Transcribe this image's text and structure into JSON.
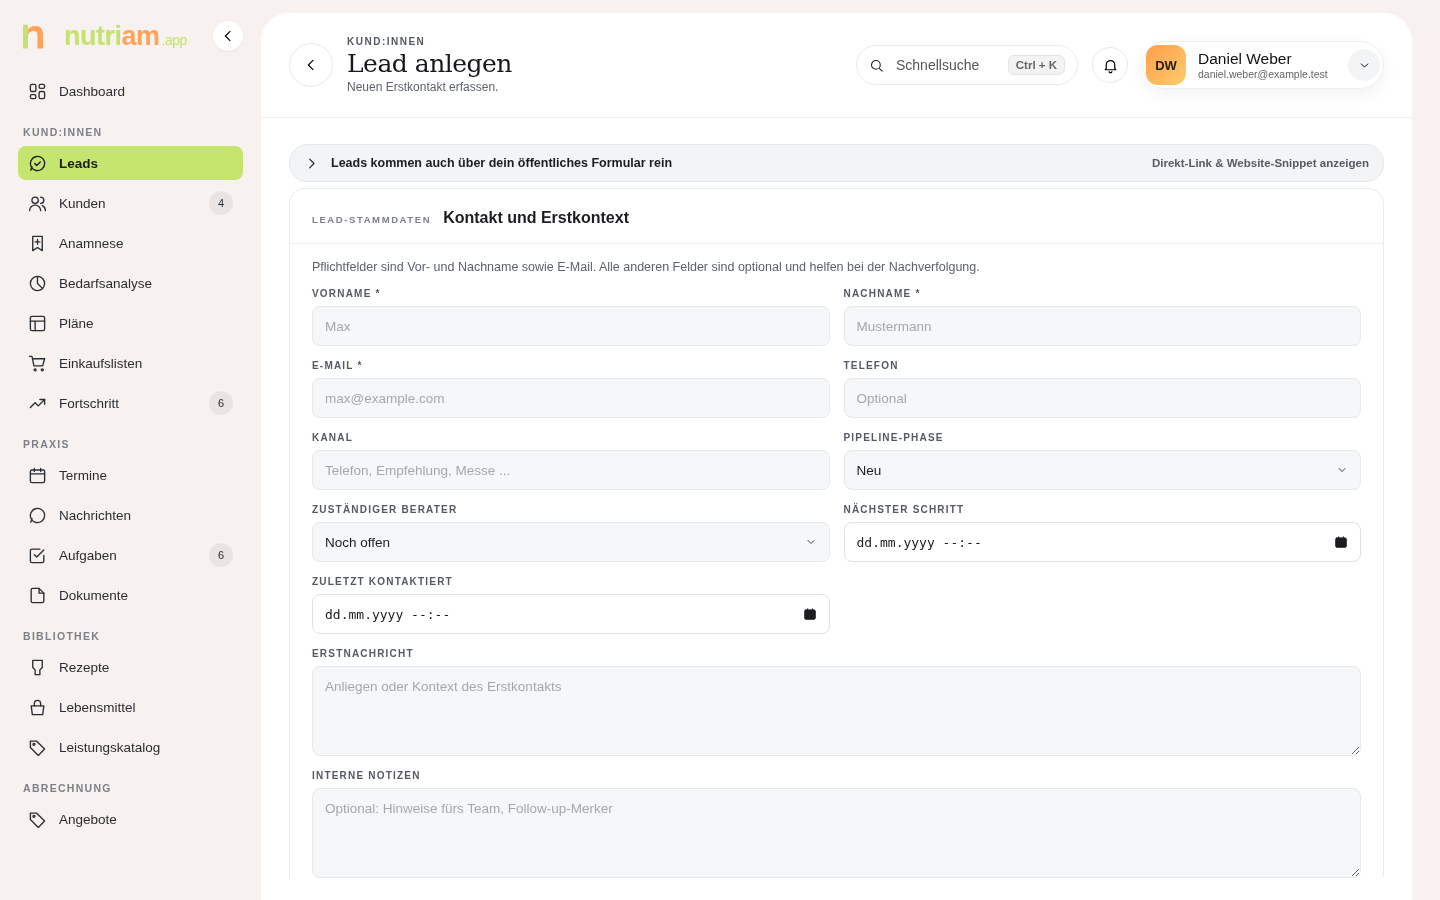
{
  "logo": {
    "text_1": "nutri",
    "text_2": "am",
    "suffix": ".app"
  },
  "sidebar": {
    "sections": [
      {
        "items": [
          {
            "label": "Dashboard",
            "selected": false
          }
        ]
      },
      {
        "heading": "KUND:INNEN",
        "items": [
          {
            "label": "Leads",
            "selected": true
          },
          {
            "label": "Kunden",
            "badge": "4",
            "selected": false
          },
          {
            "label": "Anamnese",
            "selected": false
          },
          {
            "label": "Bedarfsanalyse",
            "selected": false
          },
          {
            "label": "Pläne",
            "selected": false
          },
          {
            "label": "Einkaufslisten",
            "selected": false
          },
          {
            "label": "Fortschritt",
            "badge": "6",
            "selected": false
          }
        ]
      },
      {
        "heading": "PRAXIS",
        "items": [
          {
            "label": "Termine",
            "selected": false
          },
          {
            "label": "Nachrichten",
            "selected": false
          },
          {
            "label": "Aufgaben",
            "badge": "6",
            "selected": false
          },
          {
            "label": "Dokumente",
            "selected": false
          }
        ]
      },
      {
        "heading": "BIBLIOTHEK",
        "items": [
          {
            "label": "Rezepte",
            "selected": false
          },
          {
            "label": "Lebensmittel",
            "selected": false
          },
          {
            "label": "Leistungskatalog",
            "selected": false
          }
        ]
      },
      {
        "heading": "ABRECHNUNG",
        "items": [
          {
            "label": "Angebote",
            "selected": false
          }
        ]
      }
    ]
  },
  "header": {
    "breadcrumb": "KUND:INNEN",
    "title": "Lead anlegen",
    "subtitle": "Neuen Erstkontakt erfassen.",
    "search": {
      "placeholder": "Schnellsuche",
      "shortcut": "Ctrl + K"
    },
    "user": {
      "initials": "DW",
      "name": "Daniel Weber",
      "email": "daniel.weber@example.test"
    }
  },
  "banner": {
    "text": "Leads kommen auch über dein öffentliches Formular rein",
    "link": "Direkt-Link & Website-Snippet anzeigen",
    "expanded": false
  },
  "form": {
    "eyebrow": "LEAD-STAMMDATEN",
    "title": "Kontakt und Erstkontext",
    "hint": "Pflichtfelder sind Vor- und Nachname sowie E-Mail. Alle anderen Felder sind optional und helfen bei der Nachverfolgung.",
    "fields": [
      {
        "kind": "text",
        "label": "VORNAME *",
        "placeholder": "Max"
      },
      {
        "kind": "text",
        "label": "NACHNAME *",
        "placeholder": "Mustermann"
      },
      {
        "kind": "text",
        "label": "E-MAIL *",
        "placeholder": "max@example.com"
      },
      {
        "kind": "text",
        "label": "TELEFON",
        "placeholder": "Optional"
      },
      {
        "kind": "text",
        "label": "KANAL",
        "placeholder": "Telefon, Empfehlung, Messe ..."
      },
      {
        "kind": "select",
        "label": "PIPELINE-PHASE",
        "value": "Neu"
      },
      {
        "kind": "select",
        "label": "ZUSTÄNDIGER BERATER",
        "value": "Noch offen"
      },
      {
        "kind": "datetime",
        "label": "NÄCHSTER SCHRITT",
        "value": "dd.mm.yyyy --:--"
      },
      {
        "kind": "datetime",
        "label": "ZULETZT KONTAKTIERT",
        "value": "dd.mm.yyyy --:--"
      },
      {
        "kind": "textarea",
        "label": "ERSTNACHRICHT",
        "placeholder": "Anliegen oder Kontext des Erstkontakts"
      },
      {
        "kind": "textarea",
        "label": "INTERNE NOTIZEN",
        "placeholder": "Optional: Hinweise fürs Team, Follow-up-Merker"
      }
    ]
  }
}
